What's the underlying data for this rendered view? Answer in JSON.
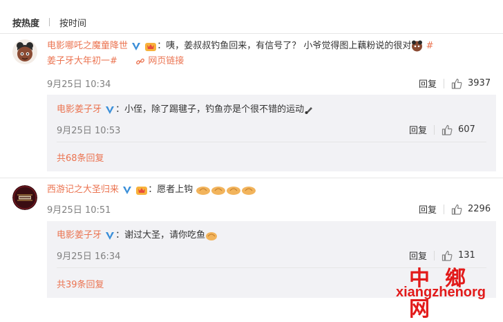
{
  "sort": {
    "hot": "按热度",
    "time": "按时间"
  },
  "comments": [
    {
      "user": "电影哪吒之魔童降世",
      "text_main": "：咦，姜叔叔钓鱼回来，有信号了？ 小爷觉得图上藕粉说的很对",
      "hashtag_end": "#",
      "text_line2": "姜子牙大年初一#",
      "web_link": "网页链接",
      "time": "9月25日 10:34",
      "reply_label": "回复",
      "likes": "3937",
      "reply": {
        "user": "电影姜子牙",
        "text": "：小侄，除了踢毽子，钓鱼亦是个很不错的运动",
        "time": "9月25日 10:53",
        "reply_label": "回复",
        "likes": "607"
      },
      "more": "共68条回复"
    },
    {
      "user": "西游记之大圣归来",
      "text": "：愿者上钩",
      "time": "9月25日 10:51",
      "reply_label": "回复",
      "likes": "2296",
      "reply": {
        "user": "电影姜子牙",
        "text": "：谢过大圣，请你吃鱼",
        "time": "9月25日 16:34",
        "reply_label": "回复",
        "likes": "131"
      },
      "more": "共39条回复"
    }
  ],
  "watermark": {
    "cn": "中鄉网",
    "en": "xiangzhenorg"
  },
  "colors": {
    "link": "#eb7350",
    "reply_bg": "#f2f2f5",
    "watermark": "#e21a1a"
  }
}
